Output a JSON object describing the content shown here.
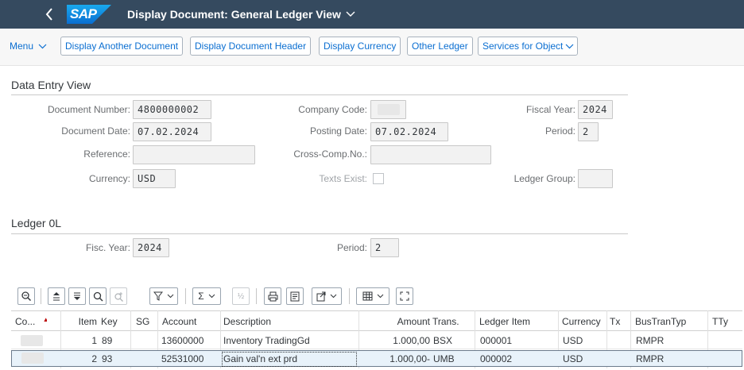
{
  "shell": {
    "back_icon": "chevron-left-icon",
    "logo_text": "SAP",
    "title": "Display Document: General Ledger View",
    "title_chevron": "chevron-down-icon",
    "brand_color": "#354a5f",
    "logo_color": "#0a6ed1"
  },
  "toolbar": {
    "menu_label": "Menu",
    "buttons": [
      "Display Another Document",
      "Display Document Header",
      "Display Currency",
      "Other Ledger",
      "Services for Object"
    ]
  },
  "data_entry": {
    "title": "Data Entry View",
    "document_number_label": "Document Number:",
    "document_number": "4800000002",
    "company_code_label": "Company Code:",
    "company_code": "",
    "fiscal_year_label": "Fiscal Year:",
    "fiscal_year": "2024",
    "document_date_label": "Document Date:",
    "document_date": "07.02.2024",
    "posting_date_label": "Posting Date:",
    "posting_date": "07.02.2024",
    "period_label": "Period:",
    "period": "2",
    "reference_label": "Reference:",
    "reference": "",
    "cross_comp_label": "Cross-Comp.No.:",
    "cross_comp": "",
    "currency_label": "Currency:",
    "currency": "USD",
    "texts_exist_label": "Texts Exist:",
    "texts_exist_checked": false,
    "ledger_group_label": "Ledger Group:",
    "ledger_group": ""
  },
  "ledger": {
    "title": "Ledger 0L",
    "fisc_year_label": "Fisc. Year:",
    "fisc_year": "2024",
    "period_label": "Period:",
    "period": "2"
  },
  "table": {
    "columns": [
      "Co...",
      "Item",
      "Key",
      "SG",
      "Account",
      "Description",
      "Amount",
      "Trans.",
      "Ledger Item",
      "Currency",
      "Tx",
      "BusTranTyp",
      "TTy"
    ],
    "rows": [
      {
        "co": "",
        "item": "1",
        "key": "89",
        "sg": "",
        "account": "13600000",
        "description": "Inventory TradingGd",
        "amount": "1.000,00",
        "trans": "BSX",
        "ledger_item": "000001",
        "currency": "USD",
        "tx": "",
        "bustrantyp": "RMPR",
        "tty": ""
      },
      {
        "co": "",
        "item": "2",
        "key": "93",
        "sg": "",
        "account": "52531000",
        "description": "Gain val'n ext prd",
        "amount": "1.000,00-",
        "trans": "UMB",
        "ledger_item": "000002",
        "currency": "USD",
        "tx": "",
        "bustrantyp": "RMPR",
        "tty": ""
      }
    ],
    "selected_row": 1
  }
}
